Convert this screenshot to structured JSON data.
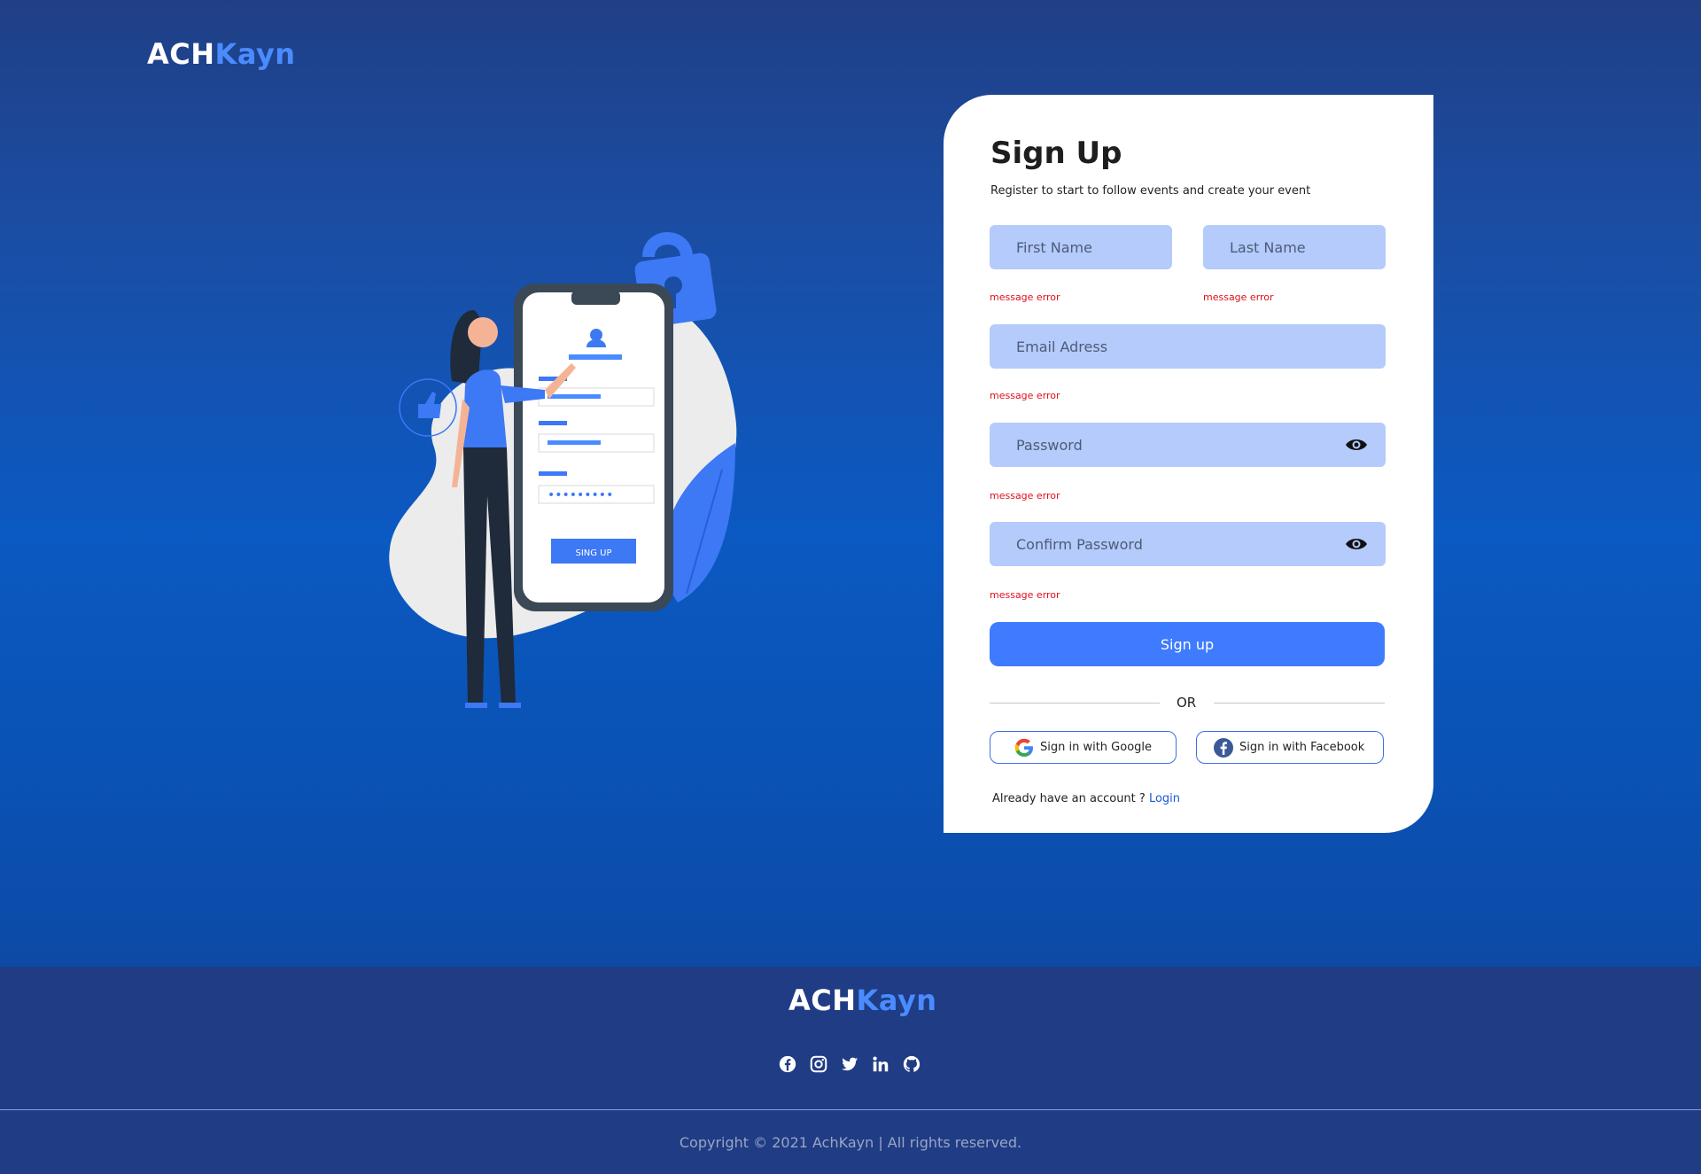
{
  "brand": {
    "part1": "ACH",
    "part2": "Kayn"
  },
  "signup": {
    "title": "Sign Up",
    "subtitle": "Register to start to follow events and create your event",
    "first_name_placeholder": "First Name",
    "last_name_placeholder": "Last Name",
    "email_placeholder": "Email Adress",
    "password_placeholder": "Password",
    "confirm_password_placeholder": "Confirm Password",
    "error_text": "message error",
    "submit_label": "Sign up",
    "or_label": "OR",
    "google_label": "Sign in with Google",
    "facebook_label": "Sign in with Facebook",
    "already_text": "Already have an account ?",
    "login_label": "Login"
  },
  "illustration": {
    "phone_button_label": "SING UP"
  },
  "footer": {
    "social_icons": [
      "facebook-icon",
      "instagram-icon",
      "twitter-icon",
      "linkedin-icon",
      "github-icon"
    ],
    "copyright": "Copyright © 2021 AchKayn | All rights reserved."
  },
  "colors": {
    "accent": "#3e7bff",
    "field_bg": "#b4cbfb",
    "error": "#e0101c",
    "footer_bg": "#1f3c85"
  }
}
